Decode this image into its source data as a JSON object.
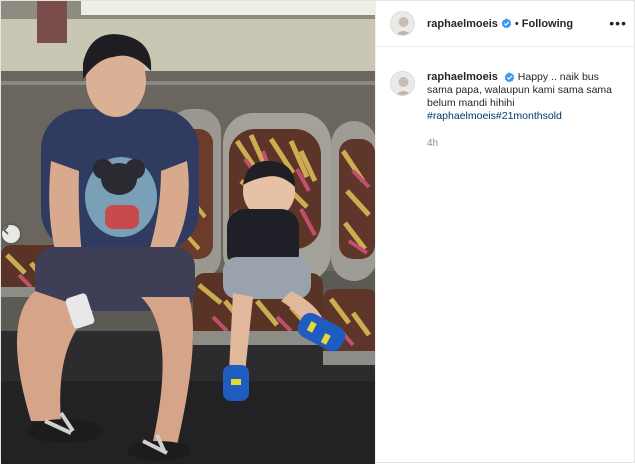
{
  "post": {
    "username": "raphaelmoeis",
    "follow_state": "Following",
    "separator": "•",
    "more_label": "•••"
  },
  "caption": {
    "username": "raphaelmoeis",
    "text": "Happy .. naik bus sama papa, walaupun kami sama sama belum mandi hihihi",
    "hashtags": [
      "#raphaelmoeis",
      "#21monthsold"
    ],
    "time": "4h"
  },
  "colors": {
    "verified_blue": "#3897f0",
    "hashtag_blue": "#00376b",
    "muted_gray": "#8e8e8e"
  },
  "icons": {
    "verified": "verified-badge-icon",
    "carousel_prev": "chevron-left-icon"
  }
}
